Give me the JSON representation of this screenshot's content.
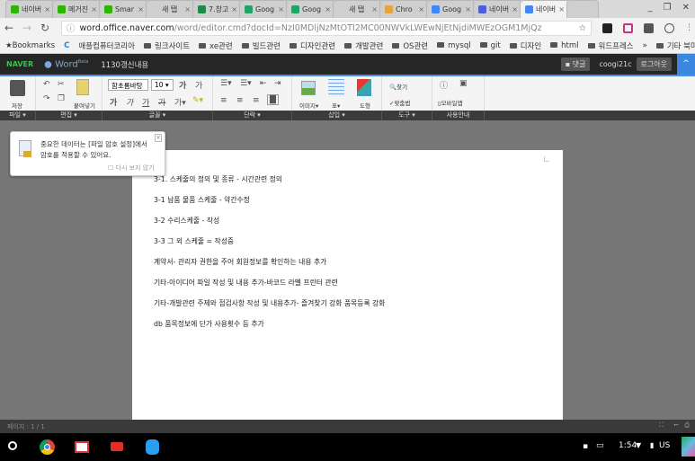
{
  "browser": {
    "tabs": [
      {
        "label": "네이버",
        "color": "#2db400"
      },
      {
        "label": "메거진",
        "color": "#2db400"
      },
      {
        "label": "Smar",
        "color": "#2db400"
      },
      {
        "label": "새 탭",
        "color": ""
      },
      {
        "label": "7.창고",
        "color": "#1d8a4a"
      },
      {
        "label": "Goog",
        "color": "#1fa463"
      },
      {
        "label": "Goog",
        "color": "#1fa463"
      },
      {
        "label": "새 탭",
        "color": ""
      },
      {
        "label": "Chro",
        "color": "#e8a33b"
      },
      {
        "label": "Goog",
        "color": "#4285f4"
      },
      {
        "label": "네이버",
        "color": "#4c5fd5"
      },
      {
        "label": "네이버",
        "color": "#4285f4",
        "active": true
      }
    ],
    "url_host": "word.office.naver.com",
    "url_path": "/word/editor.cmd?docId=NzI0MDljNzMtOTI2MC00NWVkLWEwNjEtNjdiMWEzOGM1MjQz",
    "bookmarks": [
      "Bookmarks",
      "C",
      "애플컴퓨터코리아",
      "링크사이트",
      "xe관련",
      "빌드관련",
      "디자인관련",
      "개발관련",
      "OS관련",
      "mysql",
      "git",
      "디자인",
      "html",
      "워드프레스",
      "»",
      "기타 북마크"
    ]
  },
  "app": {
    "brand": "NAVER",
    "product": "Word",
    "beta": "Beta",
    "doc_title": "1130갱신내용",
    "comment_btn": "댓글",
    "user": "coogi21c",
    "logout": "로그아웃",
    "ribbon": {
      "save": "저장",
      "paste": "붙여넣기",
      "font": "함초롬바탕",
      "size": "10",
      "image": "이미지",
      "table": "표",
      "shape": "도형",
      "find": "찾기",
      "spell": "맞춤법",
      "mobile": "모바일앱"
    },
    "groups": [
      "파일 ▾",
      "편집 ▾",
      "글꼴 ▾",
      "단락 ▾",
      "삽입 ▾",
      "도구 ▾",
      "사용안내"
    ],
    "popup": {
      "line1": "중요한 데이터는 [파일 암호 설정]에서",
      "line2": "암호를 적용할 수 있어요.",
      "dont_show": "다시 보지 않기"
    },
    "paragraphs": [
      "3-1. 스케줄의 정의 및 종류 - 시간관련 정의",
      "3-1 납품 물품 스케줄 - 약간수정",
      "3-2 수리스케줄 - 작성",
      "3-3 그 외 스케줄 = 작성중",
      "계약서- 관리자 권한을 주어 회원정보를 확인하는 내용 추가",
      "기타-아이디어 파일 작성 및 내용 추가-바코드 라벨 프린터 관련",
      "기타-개발관련 주제와 점검사항 작성 및 내용추가- 즐겨찾기 강화 품목등록 강화",
      "db 품목정보에 단가 사용횟수 등 추가"
    ],
    "page_status": "페이지 : 1 / 1"
  },
  "shelf": {
    "time": "1:54",
    "locale": "US"
  }
}
